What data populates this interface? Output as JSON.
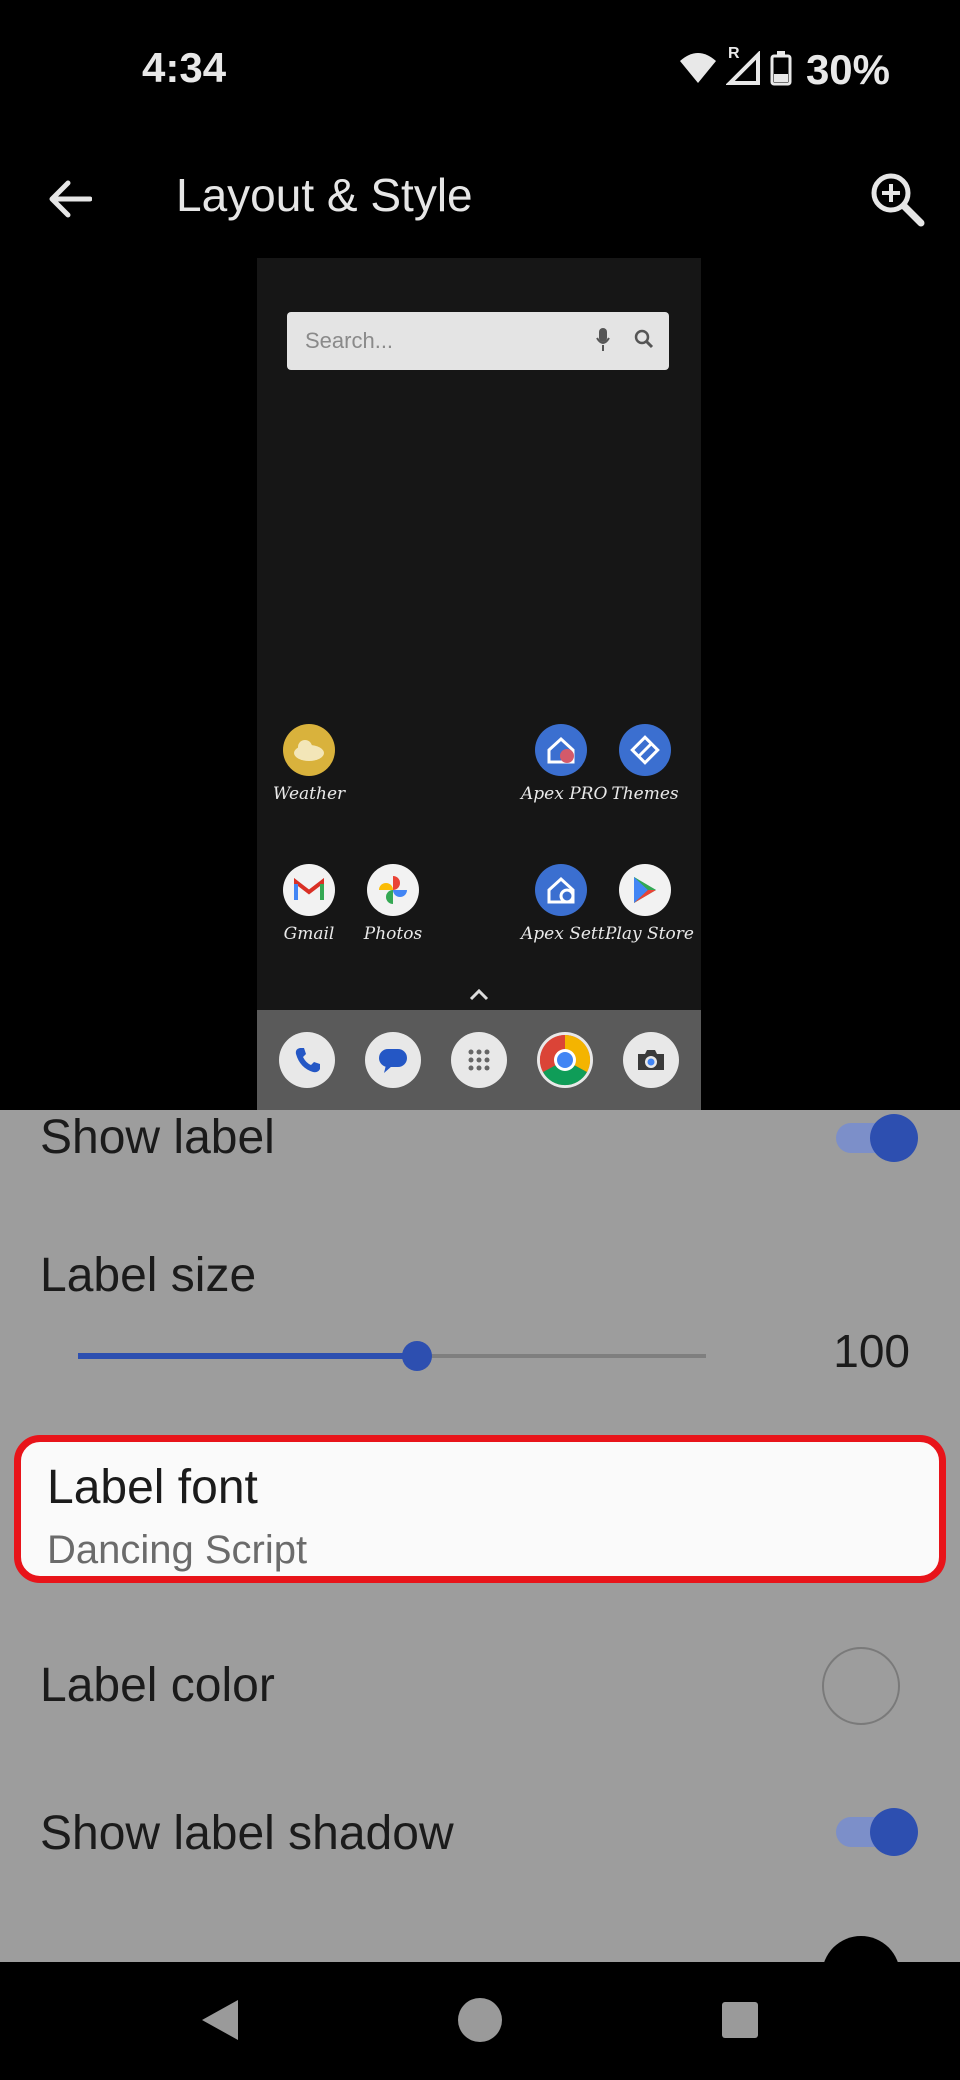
{
  "status_bar": {
    "time": "4:34",
    "battery_text": "30%",
    "roaming_indicator": "R"
  },
  "app_bar": {
    "title": "Layout & Style",
    "back_icon": "arrow-left",
    "zoom_icon": "zoom-in"
  },
  "preview": {
    "search_placeholder": "Search...",
    "apps": [
      {
        "name": "Weather",
        "icon": "weather-icon"
      },
      {
        "name": "Apex PRO",
        "icon": "apex-pro-icon"
      },
      {
        "name": "Themes",
        "icon": "themes-icon"
      },
      {
        "name": "Gmail",
        "icon": "gmail-icon"
      },
      {
        "name": "Photos",
        "icon": "photos-icon"
      },
      {
        "name": "Apex Sett...",
        "icon": "apex-settings-icon"
      },
      {
        "name": "Play Store",
        "icon": "play-store-icon"
      }
    ],
    "dock": [
      "phone-icon",
      "messages-icon",
      "app-drawer-icon",
      "chrome-icon",
      "camera-icon"
    ]
  },
  "settings": {
    "show_label": {
      "title": "Show label",
      "enabled": true
    },
    "label_size": {
      "title": "Label size",
      "value": "100",
      "fraction": 0.54
    },
    "label_font": {
      "title": "Label font",
      "summary": "Dancing Script"
    },
    "label_color": {
      "title": "Label color",
      "swatch": "#9d9d9d"
    },
    "show_label_shadow": {
      "title": "Show label shadow",
      "enabled": true
    }
  },
  "colors": {
    "accent": "#2d4fb0",
    "highlight": "#e8141a",
    "sheet_background": "#9d9d9d"
  }
}
